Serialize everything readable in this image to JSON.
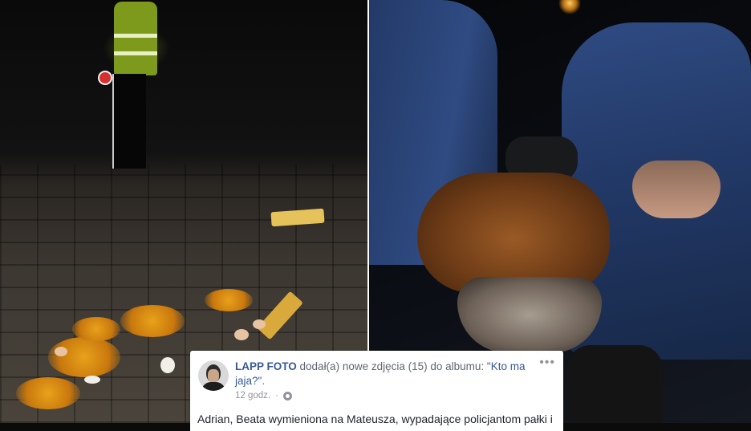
{
  "post": {
    "author": "LAPP FOTO",
    "action_before": "dodał(a) nowe zdjęcia (15) do albumu: ",
    "album_title": "\"Kto ma jaja?\"",
    "action_after": ".",
    "timestamp": "12 godz.",
    "separator": "·",
    "privacy_icon": "globe-icon",
    "more_options_icon": "more-options-icon",
    "more_options_glyph": "•••",
    "body_text": "Adrian, Beata wymieniona na Mateusza, wypadające policjantom pałki i"
  },
  "photos": {
    "left": "photo-eggs-on-pavement",
    "right": "photo-police-restraining-man"
  },
  "colors": {
    "link": "#365899",
    "meta": "#90949c",
    "body_text": "#1d2129",
    "card_bg": "#ffffff"
  }
}
